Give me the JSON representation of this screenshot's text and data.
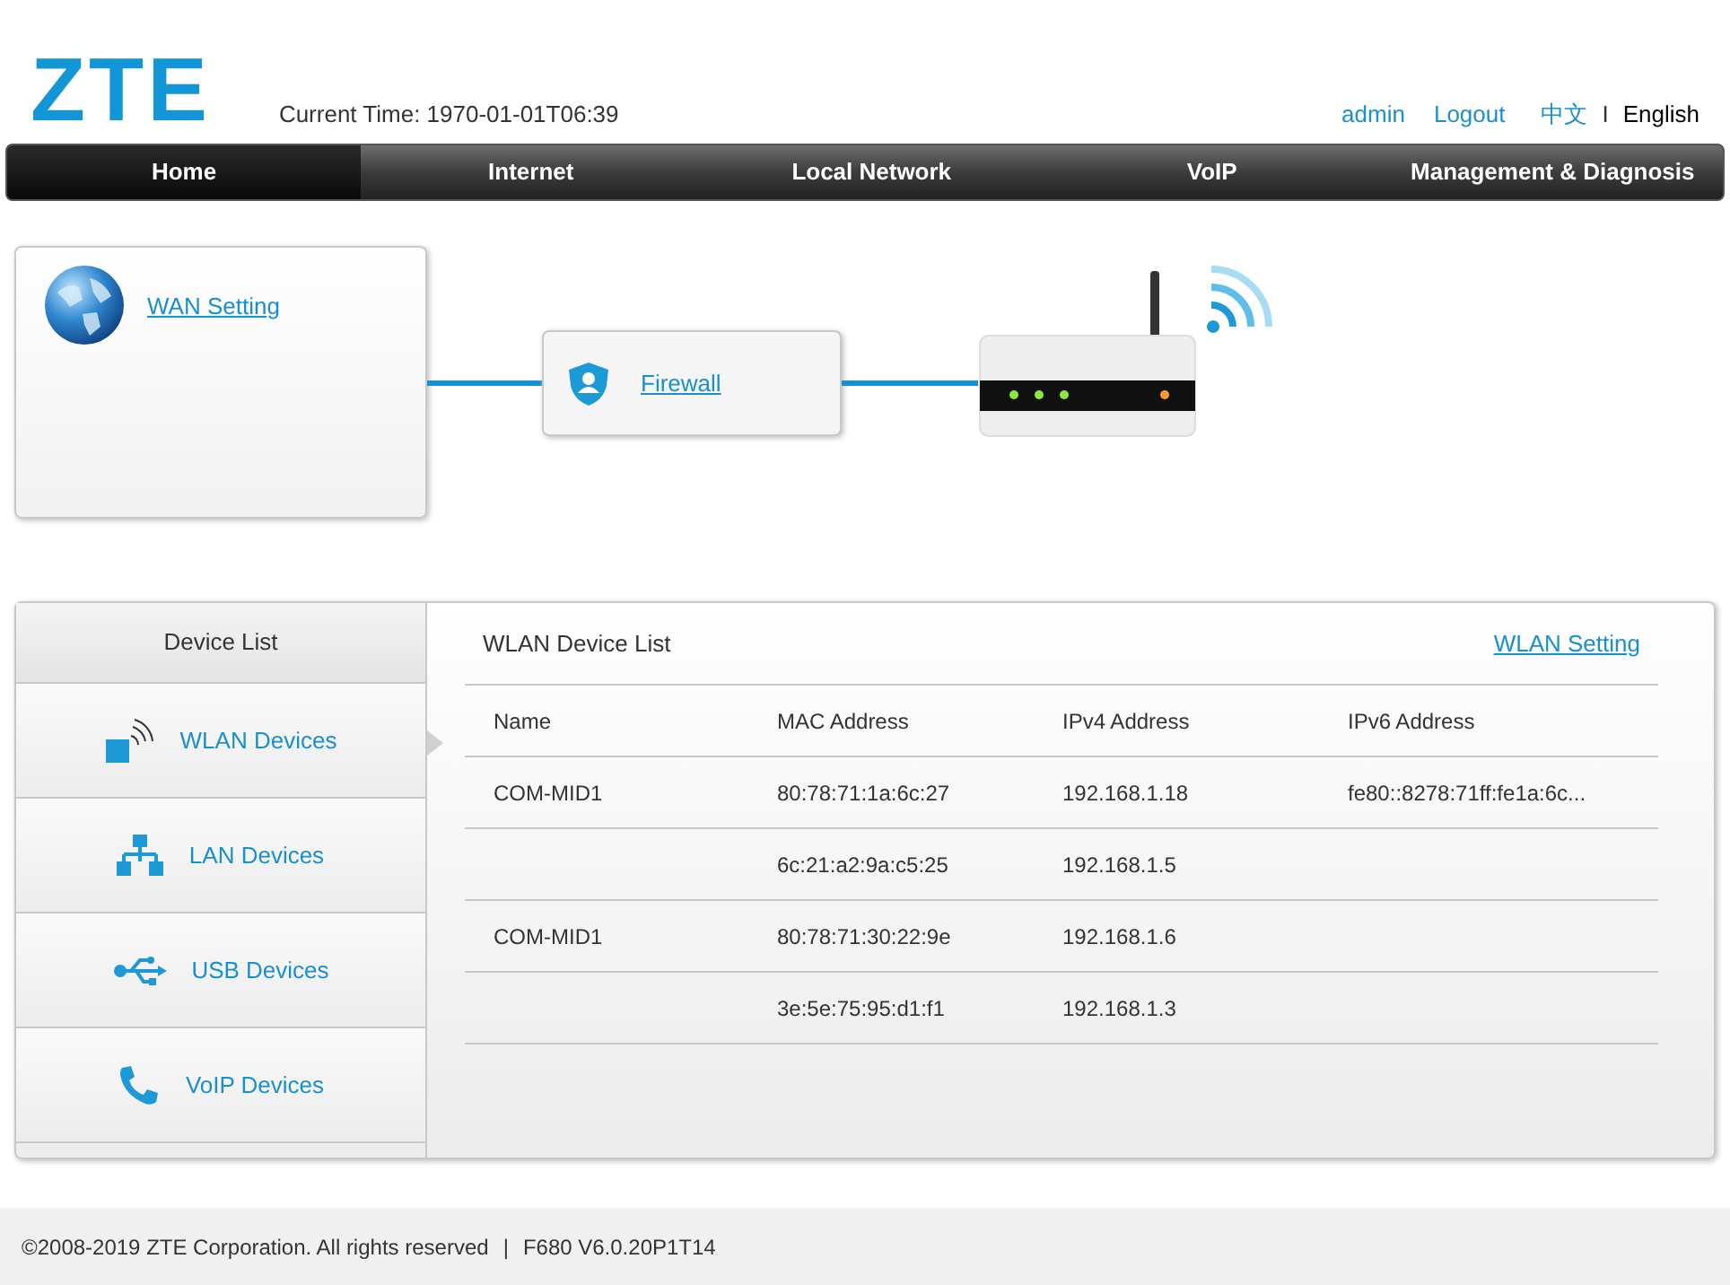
{
  "header": {
    "logo": "ZTE",
    "current_time": "Current Time: 1970-01-01T06:39",
    "user": "admin",
    "logout": "Logout",
    "languages": [
      {
        "label": "中文",
        "selected": false
      },
      {
        "label": "English",
        "selected": true
      }
    ],
    "language_separator": "I"
  },
  "nav": [
    {
      "label": "Home",
      "selected": true
    },
    {
      "label": "Internet",
      "selected": false
    },
    {
      "label": "Local Network",
      "selected": false
    },
    {
      "label": "VoIP",
      "selected": false
    },
    {
      "label": "Management & Diagnosis",
      "selected": false
    }
  ],
  "topology": {
    "wan": "WAN Setting",
    "firewall": "Firewall"
  },
  "device_list": {
    "title": "Device List",
    "items": [
      {
        "label": "WLAN Devices",
        "kind": "wlan",
        "selected": true
      },
      {
        "label": "LAN Devices",
        "kind": "lan",
        "selected": false
      },
      {
        "label": "USB Devices",
        "kind": "usb",
        "selected": false
      },
      {
        "label": "VoIP Devices",
        "kind": "voip",
        "selected": false
      }
    ]
  },
  "panel": {
    "title": "WLAN Device List",
    "link": "WLAN Setting",
    "table": {
      "columns": [
        "Name",
        "MAC Address",
        "IPv4 Address",
        "IPv6 Address"
      ],
      "rows": [
        [
          "COM-MID1",
          "80:78:71:1a:6c:27",
          "192.168.1.18",
          "fe80::8278:71ff:fe1a:6c..."
        ],
        [
          "",
          "6c:21:a2:9a:c5:25",
          "192.168.1.5",
          ""
        ],
        [
          "COM-MID1",
          "80:78:71:30:22:9e",
          "192.168.1.6",
          ""
        ],
        [
          "",
          "3e:5e:75:95:d1:f1",
          "192.168.1.3",
          ""
        ]
      ]
    }
  },
  "footer": {
    "copyright": "©2008-2019 ZTE Corporation. All rights reserved",
    "separator": "|",
    "version": "F680 V6.0.20P1T14"
  }
}
